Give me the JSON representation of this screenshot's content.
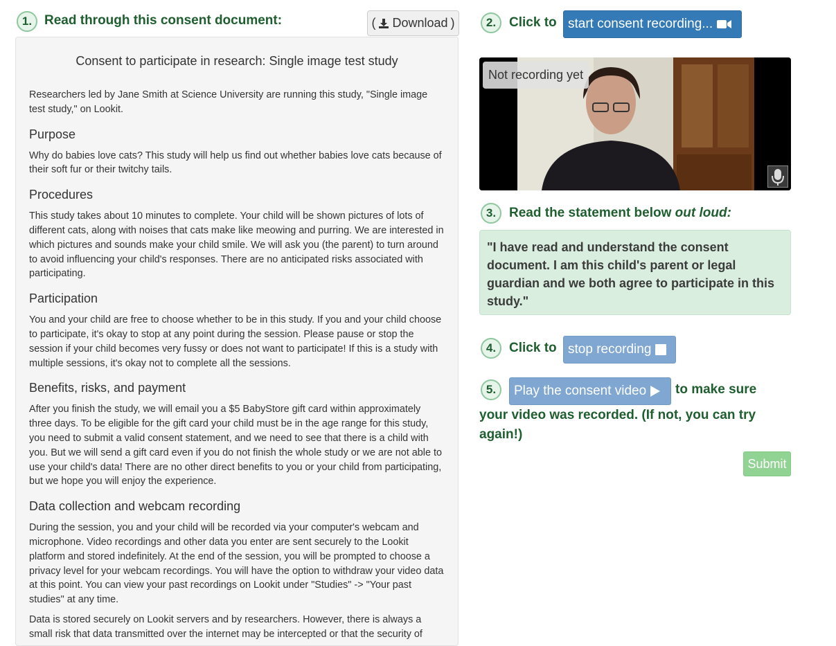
{
  "step1": {
    "number": "1.",
    "text": "Read through this consent document:"
  },
  "download": {
    "open_paren": "(",
    "label": "Download",
    "close_paren": ")"
  },
  "doc": {
    "title": "Consent to participate in research: Single image test study",
    "intro": "Researchers led by Jane Smith at Science University are running this study, \"Single image test study,\" on Lookit.",
    "sections": [
      {
        "heading": "Purpose",
        "paragraphs": [
          "Why do babies love cats? This study will help us find out whether babies love cats because of their soft fur or their twitchy tails."
        ]
      },
      {
        "heading": "Procedures",
        "paragraphs": [
          "This study takes about 10 minutes to complete. Your child will be shown pictures of lots of different cats, along with noises that cats make like meowing and purring. We are interested in which pictures and sounds make your child smile. We will ask you (the parent) to turn around to avoid influencing your child's responses. There are no anticipated risks associated with participating."
        ]
      },
      {
        "heading": "Participation",
        "paragraphs": [
          "You and your child are free to choose whether to be in this study. If you and your child choose to participate, it's okay to stop at any point during the session. Please pause or stop the session if your child becomes very fussy or does not want to participate! If this is a study with multiple sessions, it's okay not to complete all the sessions."
        ]
      },
      {
        "heading": "Benefits, risks, and payment",
        "paragraphs": [
          "After you finish the study, we will email you a $5 BabyStore gift card within approximately three days. To be eligible for the gift card your child must be in the age range for this study, you need to submit a valid consent statement, and we need to see that there is a child with you. But we will send a gift card even if you do not finish the whole study or we are not able to use your child's data! There are no other direct benefits to you or your child from participating, but we hope you will enjoy the experience."
        ]
      },
      {
        "heading": "Data collection and webcam recording",
        "paragraphs": [
          "During the session, you and your child will be recorded via your computer's webcam and microphone. Video recordings and other data you enter are sent securely to the Lookit platform and stored indefinitely. At the end of the session, you will be prompted to choose a privacy level for your webcam recordings. You will have the option to withdraw your video data at this point. You can view your past recordings on Lookit under \"Studies\" -> \"Your past studies\" at any time.",
          "Data is stored securely on Lookit servers and by researchers. However, there is always a small risk that data transmitted over the internet may be intercepted or that the security of"
        ]
      }
    ]
  },
  "step2": {
    "number": "2.",
    "text": "Click to"
  },
  "start_button": {
    "label": "start consent recording...",
    "icon": "video-camera-icon"
  },
  "video": {
    "status": "Not recording yet",
    "mic_icon": "microphone-icon"
  },
  "step3": {
    "number": "3.",
    "text": "Read the statement below ",
    "emphasis": "out loud:"
  },
  "statement": "\"I have read and understand the consent document. I am this child's parent or legal guardian and we both agree to participate in this study.\"",
  "step4": {
    "number": "4.",
    "text": "Click to"
  },
  "stop_button": {
    "label": "stop recording",
    "icon": "stop-square-icon"
  },
  "step5": {
    "number": "5.",
    "play_label": "Play the consent video",
    "play_icon": "play-triangle-icon",
    "text_line1": "to make sure",
    "text_line2": "your video was recorded. (If not, you can try",
    "text_line3": "again!)"
  },
  "submit": {
    "label": "Submit"
  },
  "colors": {
    "step_green": "#1e5e2f",
    "primary_blue": "#337ab7",
    "disabled_blue": "#7fa7d2",
    "statement_bg": "#d9eedf",
    "submit_disabled": "#90d392",
    "doc_bg": "#f5f5f5"
  }
}
